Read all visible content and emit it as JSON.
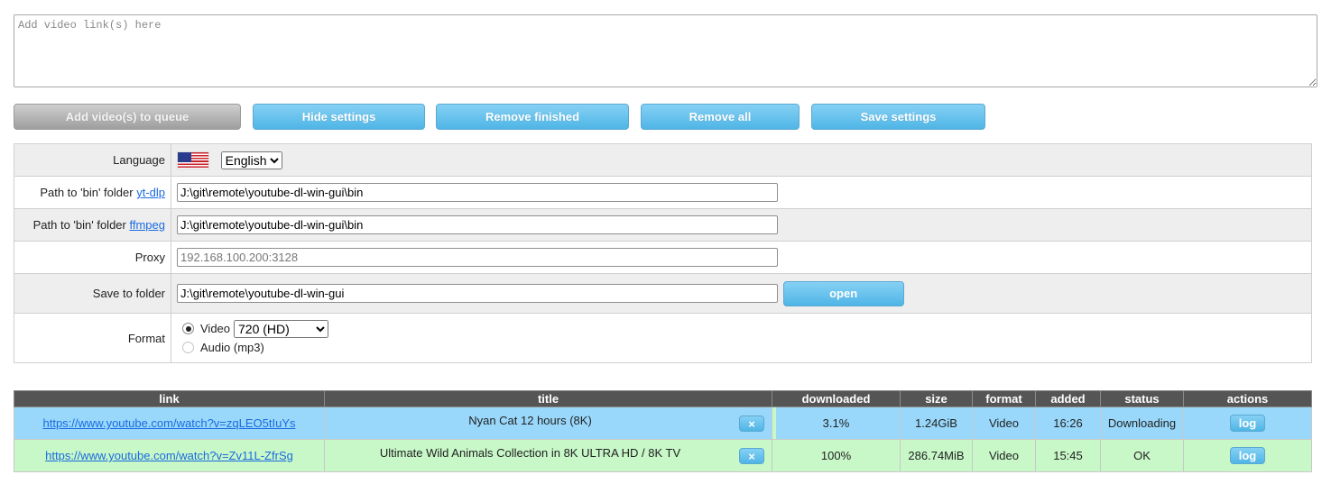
{
  "links_input": {
    "placeholder": "Add video link(s) here",
    "value": ""
  },
  "toolbar": {
    "add_label": "Add video(s) to queue",
    "hide_label": "Hide settings",
    "remove_finished_label": "Remove finished",
    "remove_all_label": "Remove all",
    "save_label": "Save settings"
  },
  "settings": {
    "language": {
      "label": "Language",
      "flag_icon": "us-flag-icon",
      "selected": "English"
    },
    "ytdlp": {
      "label": "Path to 'bin' folder ",
      "link": "yt-dlp",
      "value": "J:\\git\\remote\\youtube-dl-win-gui\\bin"
    },
    "ffmpeg": {
      "label": "Path to 'bin' folder ",
      "link": "ffmpeg",
      "value": "J:\\git\\remote\\youtube-dl-win-gui\\bin"
    },
    "proxy": {
      "label": "Proxy",
      "placeholder": "192.168.100.200:3128",
      "value": ""
    },
    "save_folder": {
      "label": "Save to folder",
      "value": "J:\\git\\remote\\youtube-dl-win-gui",
      "open_label": "open"
    },
    "format": {
      "label": "Format",
      "video_label": "Video",
      "video_quality": "720 (HD)",
      "audio_label": "Audio (mp3)",
      "selected": "Video"
    }
  },
  "queue": {
    "headers": [
      "link",
      "title",
      "downloaded",
      "size",
      "format",
      "added",
      "status",
      "actions"
    ],
    "rows": [
      {
        "link": "https://www.youtube.com/watch?v=zqLEO5tIuYs",
        "title": "Nyan Cat 12 hours (8K)",
        "remove_label": "×",
        "downloaded": "3.1%",
        "progress": 0.031,
        "size": "1.24GiB",
        "format": "Video",
        "added": "16:26",
        "status": "Downloading",
        "action_label": "log"
      },
      {
        "link": "https://www.youtube.com/watch?v=Zv11L-ZfrSg",
        "title": "Ultimate Wild Animals Collection in 8K ULTRA HD / 8K TV",
        "remove_label": "×",
        "downloaded": "100%",
        "progress": 1.0,
        "size": "286.74MiB",
        "format": "Video",
        "added": "15:45",
        "status": "OK",
        "action_label": "log"
      }
    ]
  },
  "colors": {
    "button_blue": "#4fb5e6",
    "row_downloading": "#99d8fb",
    "row_ok": "#c8f7c8",
    "header_bg": "#555555",
    "link": "#1a6be0"
  }
}
